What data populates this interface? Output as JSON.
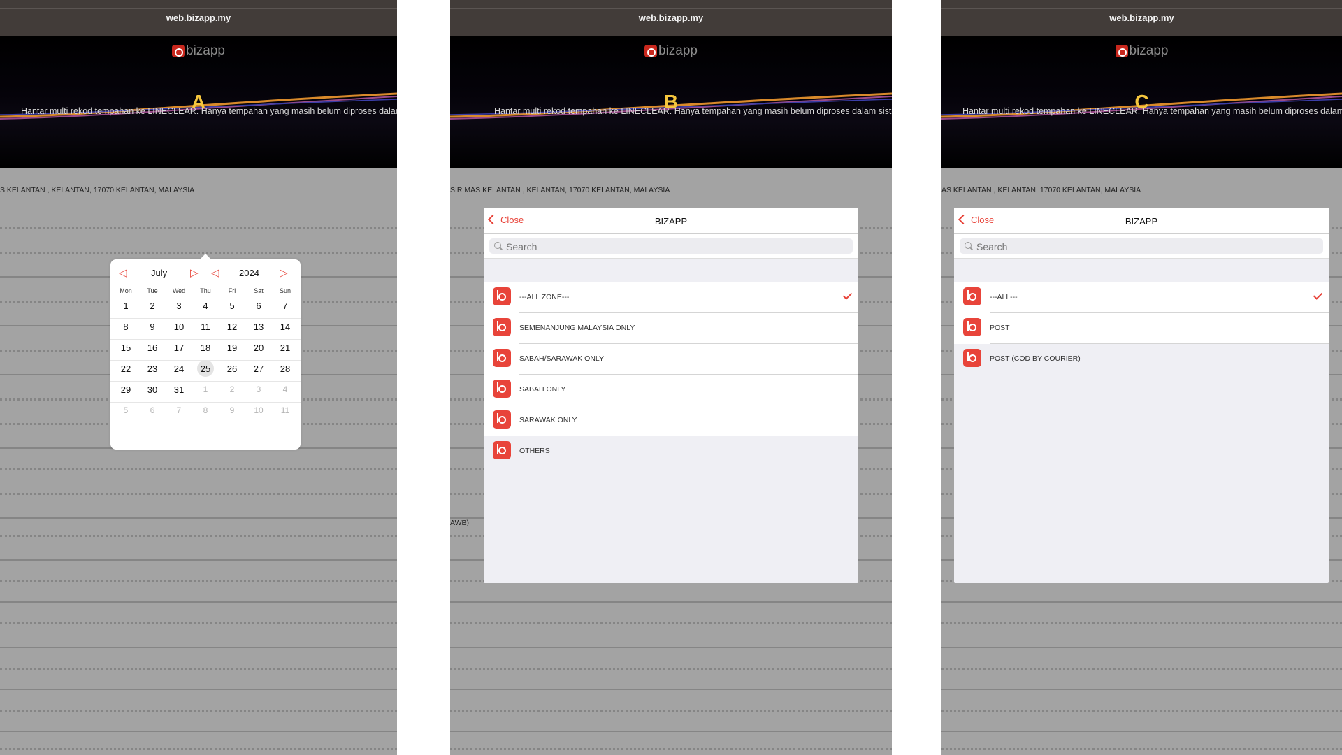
{
  "url": "web.bizapp.my",
  "logo_text": "bizapp",
  "marquee": "Hantar multi rekod tempahan ke LINECLEAR. Hanya tempahan yang masih belum diproses dalam sistem",
  "panels": {
    "a": {
      "letter": "A",
      "address": "S KELANTAN , KELANTAN, 17070 KELANTAN, MALAYSIA",
      "calendar": {
        "month": "July",
        "year": "2024",
        "prev_month": "◁",
        "next_month": "▷",
        "prev_year": "◁",
        "next_year": "▷",
        "weekdays": [
          "Mon",
          "Tue",
          "Wed",
          "Thu",
          "Fri",
          "Sat",
          "Sun"
        ],
        "weeks": [
          [
            "1",
            "2",
            "3",
            "4",
            "5",
            "6",
            "7"
          ],
          [
            "8",
            "9",
            "10",
            "11",
            "12",
            "13",
            "14"
          ],
          [
            "15",
            "16",
            "17",
            "18",
            "19",
            "20",
            "21"
          ],
          [
            "22",
            "23",
            "24",
            "25",
            "26",
            "27",
            "28"
          ],
          [
            "29",
            "30",
            "31",
            "1",
            "2",
            "3",
            "4"
          ],
          [
            "5",
            "6",
            "7",
            "8",
            "9",
            "10",
            "11"
          ]
        ],
        "today": "25"
      }
    },
    "b": {
      "letter": "B",
      "address": "SIR MAS KELANTAN , KELANTAN, 17070 KELANTAN, MALAYSIA",
      "bottom_text": "AWB)",
      "modal": {
        "close": "Close",
        "title": "BIZAPP",
        "search_placeholder": "Search",
        "items": [
          "---ALL ZONE---",
          "SEMENANJUNG MALAYSIA ONLY",
          "SABAH/SARAWAK ONLY",
          "SABAH ONLY",
          "SARAWAK ONLY",
          "OTHERS"
        ],
        "selected": "---ALL ZONE---"
      }
    },
    "c": {
      "letter": "C",
      "address": "AS KELANTAN , KELANTAN, 17070 KELANTAN, MALAYSIA",
      "modal": {
        "close": "Close",
        "title": "BIZAPP",
        "search_placeholder": "Search",
        "items": [
          "---ALL---",
          "POST",
          "POST (COD BY COURIER)"
        ],
        "selected": "---ALL---"
      }
    }
  }
}
